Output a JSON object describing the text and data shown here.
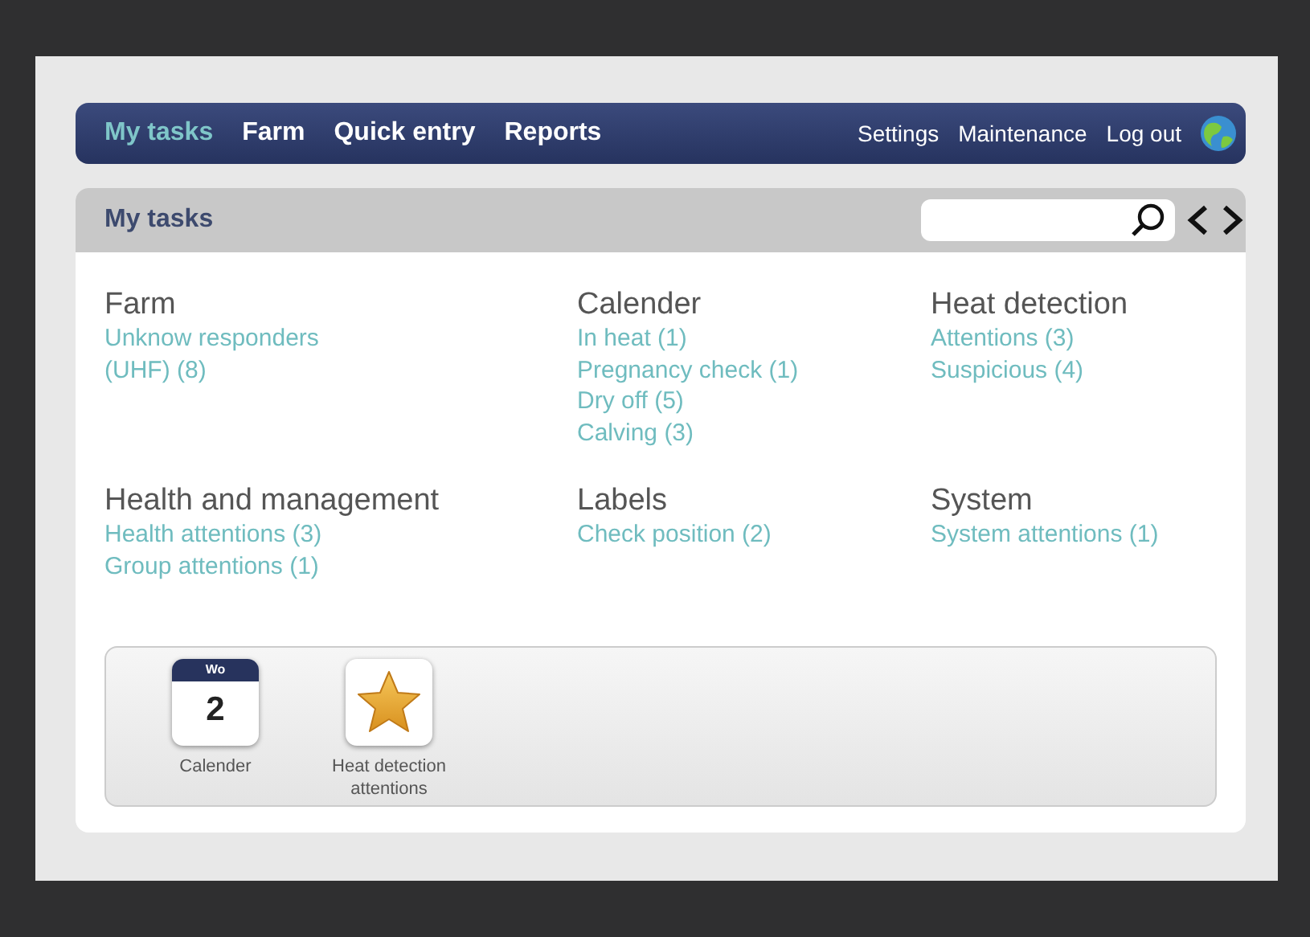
{
  "nav": {
    "items": [
      {
        "label": "My tasks",
        "selected": true
      },
      {
        "label": "Farm",
        "selected": false
      },
      {
        "label": "Quick entry",
        "selected": false
      },
      {
        "label": "Reports",
        "selected": false
      }
    ],
    "links": [
      "Settings",
      "Maintenance",
      "Log out"
    ]
  },
  "header": {
    "title": "My tasks"
  },
  "sections": [
    {
      "title": "Farm",
      "links": [
        "Unknow responders\n(UHF) (8)"
      ]
    },
    {
      "title": "Calender",
      "links": [
        "In heat (1)",
        "Pregnancy check (1)",
        "Dry off (5)",
        "Calving (3)"
      ]
    },
    {
      "title": "Heat detection",
      "links": [
        "Attentions (3)",
        "Suspicious (4)"
      ]
    },
    {
      "title": "Health and management",
      "links": [
        "Health attentions (3)",
        "Group attentions (1)"
      ]
    },
    {
      "title": "Labels",
      "links": [
        "Check position (2)"
      ]
    },
    {
      "title": "System",
      "links": [
        "System attentions (1)"
      ]
    }
  ],
  "shortcuts": [
    {
      "kind": "calendar",
      "day": "Wo",
      "date": "2",
      "label": "Calender"
    },
    {
      "kind": "star",
      "label": "Heat detection attentions"
    }
  ]
}
